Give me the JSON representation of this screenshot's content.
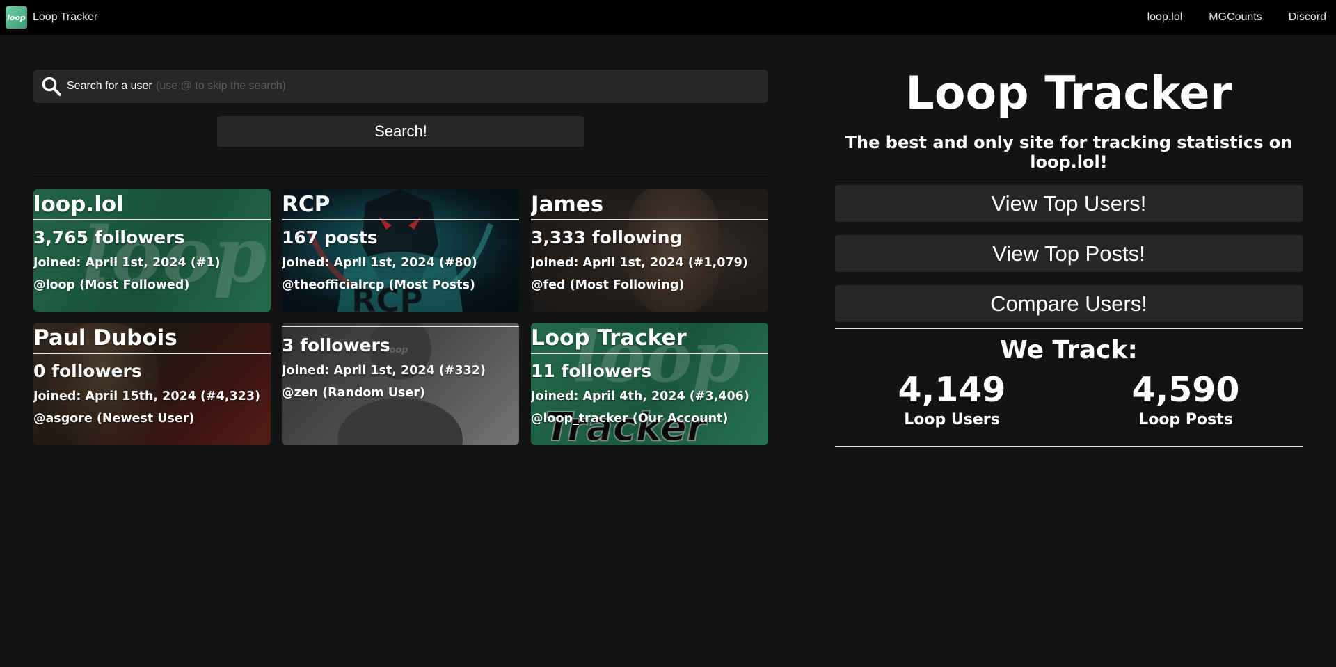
{
  "nav": {
    "brand_logo_text": "loop",
    "brand": "Loop Tracker",
    "links": [
      "loop.lol",
      "MGCounts",
      "Discord"
    ]
  },
  "search": {
    "placeholder": "Search for a user",
    "hint": "(use @ to skip the search)",
    "button": "Search!"
  },
  "cards": [
    {
      "title": "loop.lol",
      "stat": "3,765 followers",
      "joined": "Joined: April 1st, 2024 (#1)",
      "handle": "@loop (Most Followed)",
      "bg_text": "loop"
    },
    {
      "title": "RCP",
      "stat": "167 posts",
      "joined": "Joined: April 1st, 2024 (#80)",
      "handle": "@theofficialrcp (Most Posts)",
      "bg_text": "RCP"
    },
    {
      "title": "James",
      "stat": "3,333 following",
      "joined": "Joined: April 1st, 2024 (#1,079)",
      "handle": "@fed (Most Following)"
    },
    {
      "title": "Paul Dubois",
      "stat": "0 followers",
      "joined": "Joined: April 15th, 2024 (#4,323)",
      "handle": "@asgore (Newest User)"
    },
    {
      "title": "",
      "stat": "3 followers",
      "joined": "Joined: April 1st, 2024 (#332)",
      "handle": "@zen (Random User)",
      "bg_text": "loop"
    },
    {
      "title": "Loop Tracker",
      "stat": "11 followers",
      "joined": "Joined: April 4th, 2024 (#3,406)",
      "handle": "@loop_tracker (Our Account)",
      "bg_text": "loop",
      "bg_text2": "Tracker"
    }
  ],
  "hero": {
    "title": "Loop Tracker",
    "subtitle": "The best and only site for tracking statistics on loop.lol!",
    "buttons": [
      "View Top Users!",
      "View Top Posts!",
      "Compare Users!"
    ],
    "track_title": "We Track:",
    "stats": [
      {
        "value": "4,149",
        "label": "Loop Users"
      },
      {
        "value": "4,590",
        "label": "Loop Posts"
      }
    ]
  },
  "colors": {
    "background": "#121413",
    "nav": "#000000",
    "panel": "#262827",
    "loop_green": "#2f8a63"
  }
}
